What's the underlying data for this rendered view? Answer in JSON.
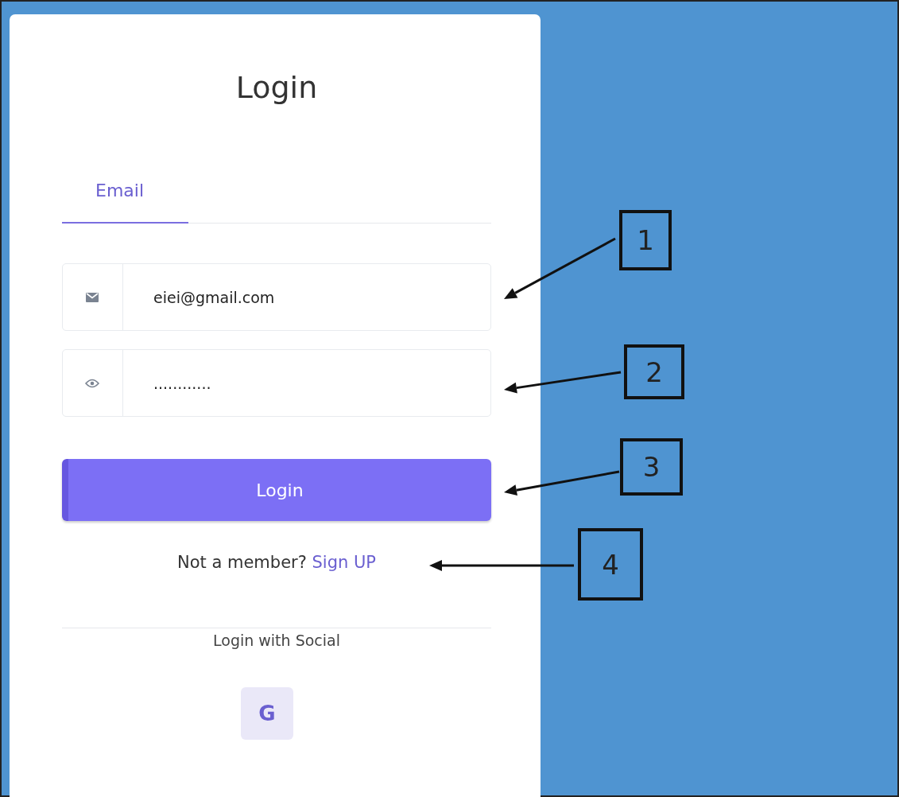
{
  "title": "Login",
  "tabs": [
    {
      "label": "Email",
      "selected": true
    }
  ],
  "email_field": {
    "value": "eiei@gmail.com"
  },
  "password_field": {
    "value": "............"
  },
  "login_button": {
    "label": "Login"
  },
  "signup_prompt": {
    "text": "Not a member?",
    "link": "Sign UP"
  },
  "social": {
    "label": "Login with Social",
    "buttons": [
      {
        "kind": "google",
        "label": "G"
      }
    ]
  },
  "callouts": [
    {
      "label": "1"
    },
    {
      "label": "2"
    },
    {
      "label": "3"
    },
    {
      "label": "4"
    }
  ]
}
